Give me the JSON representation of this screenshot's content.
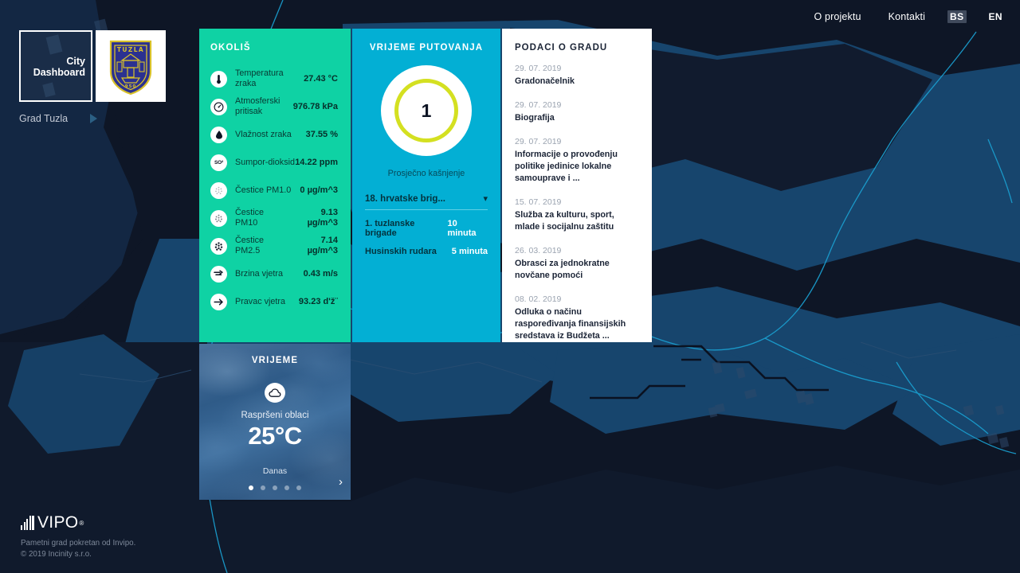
{
  "topnav": {
    "links": [
      {
        "label": "O projektu",
        "name": "nav-about"
      },
      {
        "label": "Kontakti",
        "name": "nav-contacts"
      }
    ],
    "languages": [
      {
        "label": "BS",
        "active": true
      },
      {
        "label": "EN",
        "active": false
      }
    ]
  },
  "brand": {
    "dashboard_tile_label": "City\nDashboard",
    "crest_alt": "tuzla-crest",
    "crest_text_top": "TUZLA",
    "crest_text_bottom": "950",
    "city_name": "Grad Tuzla"
  },
  "environment": {
    "title": "OKOLIŠ",
    "rows": [
      {
        "icon": "thermometer-icon",
        "label": "Temperatura zraka",
        "value": "27.43 °C"
      },
      {
        "icon": "barometer-icon",
        "label": "Atmosferski pritisak",
        "value": "976.78 kPa"
      },
      {
        "icon": "droplet-icon",
        "label": "Vlažnost zraka",
        "value": "37.55 %"
      },
      {
        "icon": "so2-icon",
        "label": "Sumpor-dioksid",
        "value": "14.22 ppm"
      },
      {
        "icon": "particles-pm1-icon",
        "label": "Čestice PM1.0",
        "value": "0 µg/m^3"
      },
      {
        "icon": "particles-pm10-icon",
        "label": "Čestice PM10",
        "value": "9.13 µg/m^3"
      },
      {
        "icon": "particles-pm25-icon",
        "label": "Čestice PM2.5",
        "value": "7.14 µg/m^3"
      },
      {
        "icon": "wind-speed-icon",
        "label": "Brzina vjetra",
        "value": "0.43 m/s"
      },
      {
        "icon": "wind-direction-icon",
        "label": "Pravac vjetra",
        "value": "93.23 d'ž¨"
      }
    ]
  },
  "travel": {
    "title": "VRIJEME PUTOVANJA",
    "gauge_value": "1",
    "gauge_color": "#d4e021",
    "caption": "Prosječno kašnjenje",
    "selected_route": "18. hrvatske brig...",
    "routes": [
      {
        "name": "1. tuzlanske brigade",
        "time": "10 minuta"
      },
      {
        "name": "Husinskih rudara",
        "time": "5 minuta"
      }
    ]
  },
  "city": {
    "title": "PODACI O GRADU",
    "news": [
      {
        "date": "29. 07. 2019",
        "title": "Gradonačelnik"
      },
      {
        "date": "29. 07. 2019",
        "title": "Biografija"
      },
      {
        "date": "29. 07. 2019",
        "title": "Informacije o provođenju politike jedinice lokalne samouprave i ..."
      },
      {
        "date": "15. 07. 2019",
        "title": "Služba za kulturu, sport, mlade i socijalnu zaštitu"
      },
      {
        "date": "26. 03. 2019",
        "title": "Obrasci za jednokratne novčane pomoći"
      },
      {
        "date": "08. 02. 2019",
        "title": "Odluka o načinu raspoređivanja finansijskih sredstava iz Budžeta ..."
      }
    ]
  },
  "weather": {
    "title": "VRIJEME",
    "icon": "cloud-icon",
    "description": "Raspršeni oblaci",
    "temperature": "25°C",
    "day": "Danas",
    "dots": 5,
    "active_dot": 0,
    "next_label": "›"
  },
  "footer": {
    "wordmark": "VIPO",
    "registered": "®",
    "line1": "Pametni grad pokretan od Invipo.",
    "line2": "© 2019 Incinity s.r.o."
  },
  "theme": {
    "env_bg": "#0fd2a4",
    "travel_bg": "#03afd4",
    "city_bg": "#ffffff",
    "map_bg": "#0e1626",
    "map_land": "#17456d",
    "map_water": "#1a9ccc"
  }
}
